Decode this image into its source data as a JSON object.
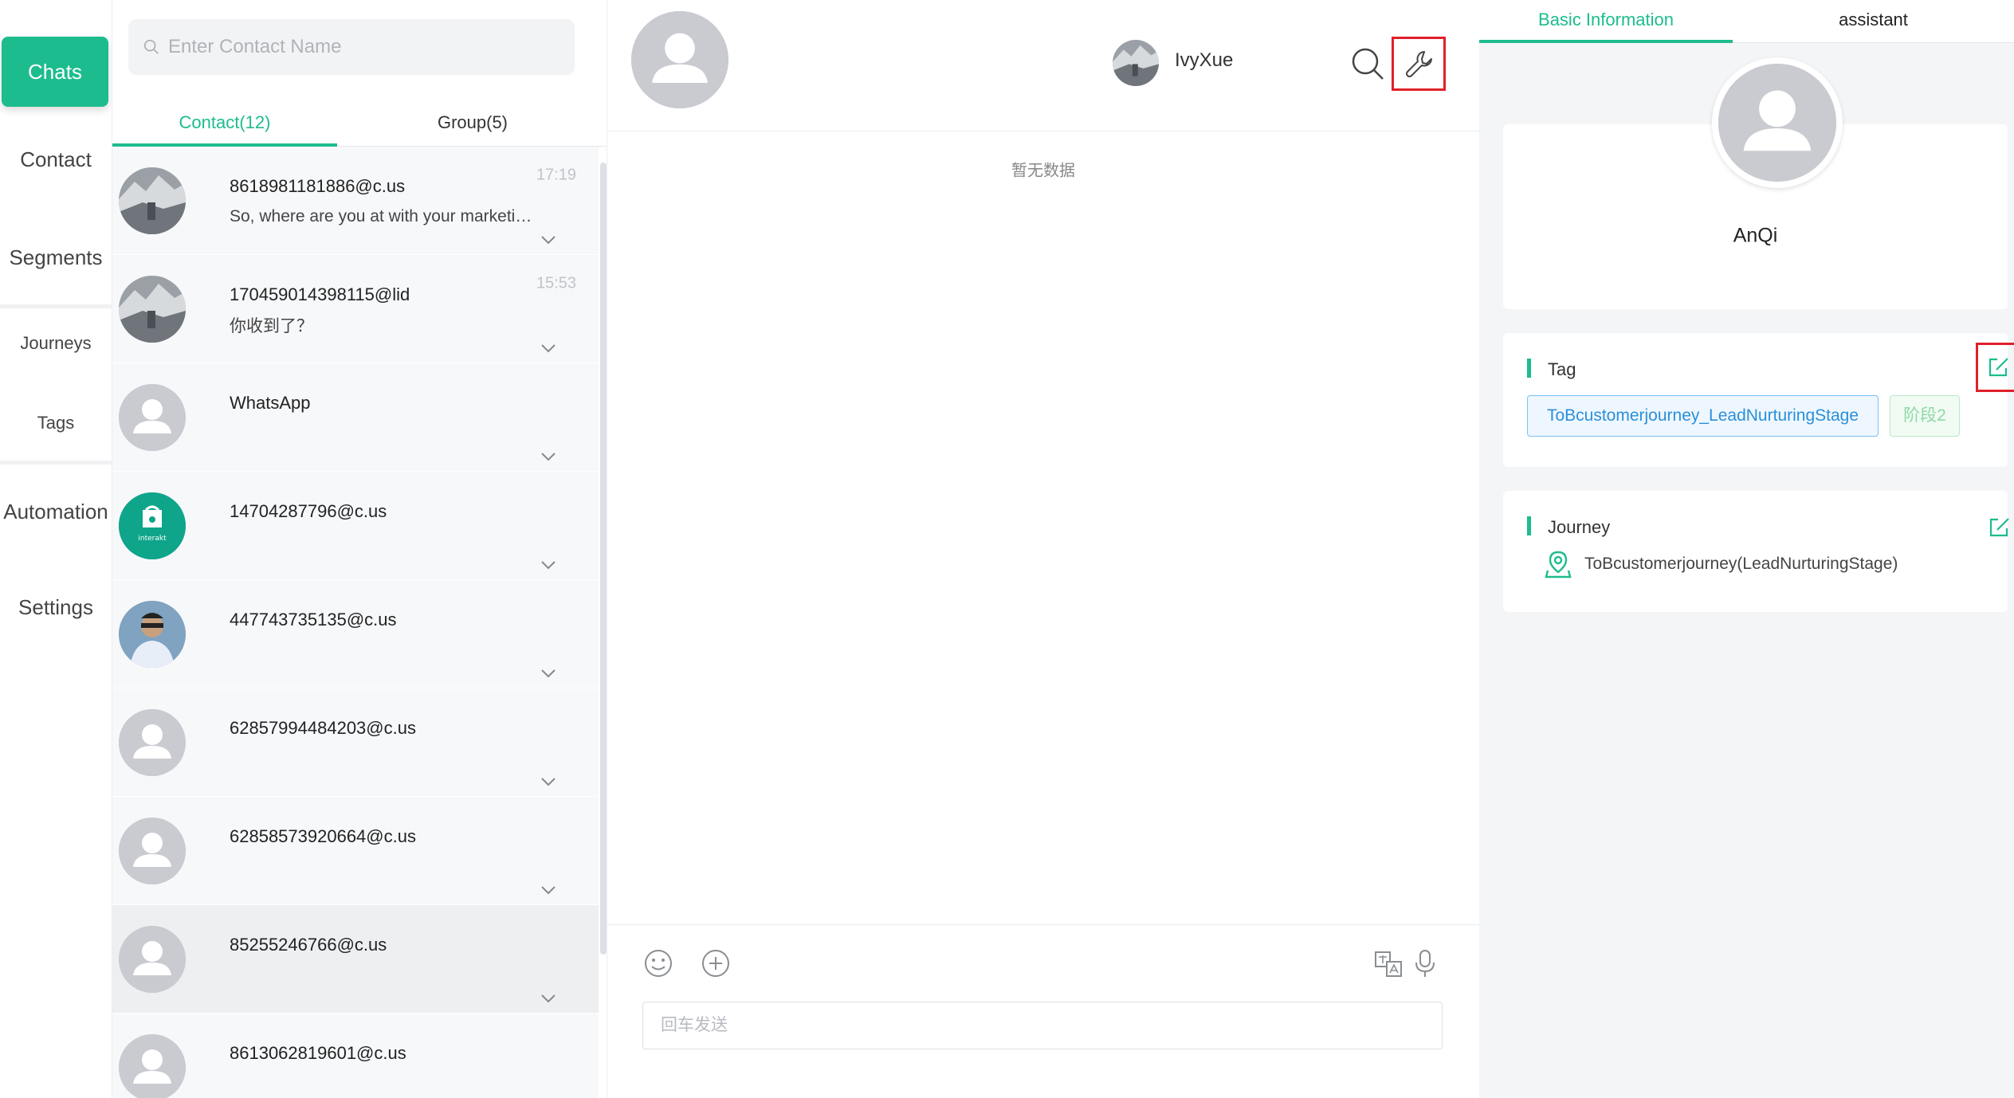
{
  "nav": {
    "items": [
      {
        "label": "Chats"
      },
      {
        "label": "Contact"
      },
      {
        "label": "Segments"
      },
      {
        "label": "Journeys"
      },
      {
        "label": "Tags"
      },
      {
        "label": "Automation"
      },
      {
        "label": "Settings"
      }
    ],
    "active_color": "#1dbc8f"
  },
  "contacts": {
    "search_placeholder": "Enter Contact Name",
    "tabs": [
      {
        "label": "Contact(12)"
      },
      {
        "label": "Group(5)"
      }
    ],
    "list": [
      {
        "name": "8618981181886@c.us",
        "message": "So, where are you at with your marketi…",
        "time": "17:19",
        "avatar": "photo-glacier"
      },
      {
        "name": "170459014398115@lid",
        "message": "你收到了？",
        "time": "15:53",
        "avatar": "photo-glacier"
      },
      {
        "name": "WhatsApp",
        "message": "",
        "time": "",
        "avatar": "default-user"
      },
      {
        "name": "14704287796@c.us",
        "message": "",
        "time": "",
        "avatar": "interakt-logo"
      },
      {
        "name": "447743735135@c.us",
        "message": "",
        "time": "",
        "avatar": "photo-man"
      },
      {
        "name": "62857994484203@c.us",
        "message": "",
        "time": "",
        "avatar": "default-user"
      },
      {
        "name": "62858573920664@c.us",
        "message": "",
        "time": "",
        "avatar": "default-user"
      },
      {
        "name": "85255246766@c.us",
        "message": "",
        "time": "",
        "avatar": "default-user"
      },
      {
        "name": "8613062819601@c.us",
        "message": "",
        "time": "",
        "avatar": "default-user"
      }
    ]
  },
  "chat": {
    "agent_name": "IvyXue",
    "empty_text": "暂无数据",
    "input_placeholder": "回车发送"
  },
  "panel": {
    "tabs": [
      {
        "label": "Basic Information"
      },
      {
        "label": "assistant"
      }
    ],
    "profile_name": "AnQi",
    "tag_title": "Tag",
    "tags": [
      "ToBcustomerjourney_LeadNurturingStage",
      "阶段2"
    ],
    "journey_title": "Journey",
    "journey_value": "ToBcustomerjourney(LeadNurturingStage)"
  },
  "interakt_logo_text": "interakt",
  "colors": {
    "accent": "#1dbc8f",
    "highlight_box": "#e0202a",
    "tag_blue": "#2b8fd8",
    "tag_green": "#8fd8a6"
  }
}
